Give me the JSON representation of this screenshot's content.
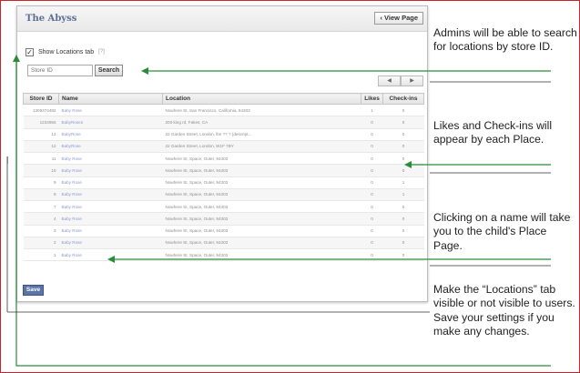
{
  "panel": {
    "title": "The Abyss",
    "view_page_label": "‹ View Page",
    "show_tab_label": "Show Locations tab",
    "show_tab_checked": true,
    "help_mark": "[?]",
    "search_placeholder": "Store ID",
    "search_label": "Search",
    "pager_prev": "◀",
    "pager_next": "▶",
    "save_label": "Save"
  },
  "table": {
    "headers": [
      "Store ID",
      "Name",
      "Location",
      "Likes",
      "Check-ins"
    ],
    "rows": [
      [
        "1309374482",
        "Baby Rose",
        "Nowhere St, San Francisco, California, 94303",
        "1",
        "0"
      ],
      [
        "1234956",
        "BabyRose2",
        "200 king rd, Fakes, CA",
        "0",
        "0"
      ],
      [
        "13",
        "BabyRose",
        "22 Garden Street, London, lbn ?? ? (descript...",
        "0",
        "0"
      ],
      [
        "12",
        "BabyRose",
        "22 Garden Street, London, W1F 7BY",
        "0",
        "0"
      ],
      [
        "11",
        "Baby Rose",
        "Nowhere St, Space, Outer, 94303",
        "0",
        "0"
      ],
      [
        "10",
        "Baby Rose",
        "Nowhere St, Space, Outer, 94303",
        "0",
        "0"
      ],
      [
        "9",
        "Baby Rose",
        "Nowhere St, Space, Outer, 94303",
        "0",
        "1"
      ],
      [
        "8",
        "Baby Rose",
        "Nowhere St, Space, Outer, 94303",
        "0",
        "1"
      ],
      [
        "7",
        "Baby Rose",
        "Nowhere St, Space, Outer, 94303",
        "0",
        "0"
      ],
      [
        "4",
        "Baby Rose",
        "Nowhere St, Space, Outer, 94303",
        "0",
        "0"
      ],
      [
        "3",
        "Baby Rose",
        "Nowhere St, Space, Outer, 94303",
        "0",
        "0"
      ],
      [
        "2",
        "Baby Rose",
        "Nowhere St, Space, Outer, 94303",
        "0",
        "0"
      ],
      [
        "1",
        "Baby Rose",
        "Nowhere St, Space, Outer, 94303",
        "0",
        "0"
      ]
    ]
  },
  "callouts": {
    "search": "Admins will be able to search for locations by store ID.",
    "likes": "Likes and Check-ins will appear by each Place.",
    "name": "Clicking on a name will take you to the child's Place Page.",
    "save": "Make the “Locations” tab visible or not visible to users. Save your settings if you make any changes."
  },
  "colors": {
    "arrow": "#2a8c3a",
    "frame": "#c9252c",
    "title": "#5b6f97",
    "link": "#8b9ad1",
    "save_button": "#5b74a8"
  },
  "icons": {
    "view_page": "chevron-left-icon",
    "pager_prev": "arrow-left-icon",
    "pager_next": "arrow-right-icon",
    "checkbox": "checkmark-icon"
  }
}
